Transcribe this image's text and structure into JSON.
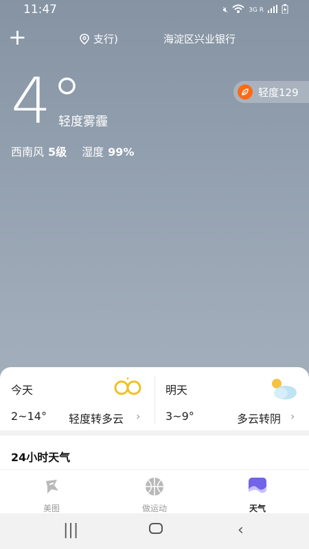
{
  "status": {
    "time": "11:47",
    "network": "3G R"
  },
  "topbar": {
    "location_1": "支行)",
    "location_2": "海淀区兴业银行"
  },
  "current": {
    "temperature": "4°",
    "condition": "轻度雾霾",
    "aqi_label": "轻度129",
    "wind_label": "西南风",
    "wind_value": "5级",
    "humidity_label": "湿度",
    "humidity_value": "99%"
  },
  "forecast": [
    {
      "day": "今天",
      "range": "2~14°",
      "desc": "轻度转多云"
    },
    {
      "day": "明天",
      "range": "3~9°",
      "desc": "多云转阴"
    }
  ],
  "section_24h": "24小时天气",
  "bottom_nav": [
    {
      "label": "美图",
      "active": false
    },
    {
      "label": "做运动",
      "active": false
    },
    {
      "label": "天气",
      "active": true
    }
  ],
  "colors": {
    "accent_orange": "#ff6a13",
    "sky_top": "#8593a3",
    "sky_bottom": "#a9b3bf"
  }
}
